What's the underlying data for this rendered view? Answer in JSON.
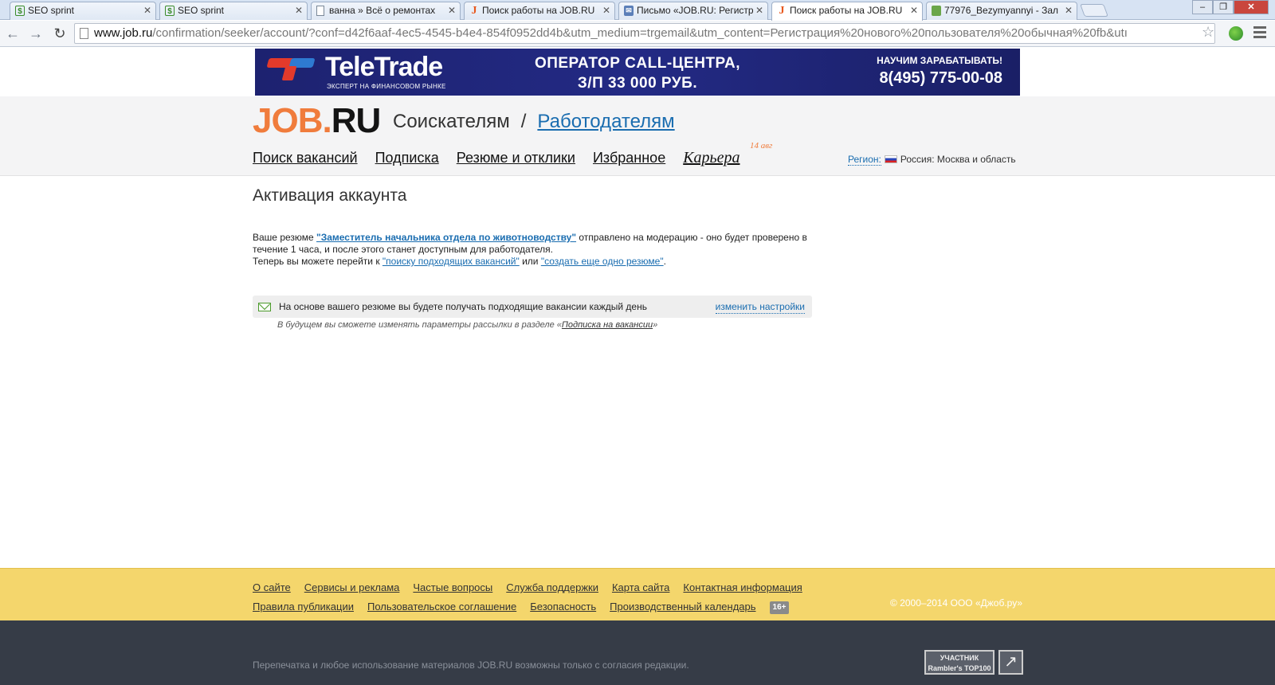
{
  "browser": {
    "tabs": [
      {
        "title": "SEO sprint",
        "icon": "seo-sprint-icon"
      },
      {
        "title": "SEO sprint",
        "icon": "seo-sprint-icon"
      },
      {
        "title": "ванна » Всё о ремонтах",
        "icon": "page-icon"
      },
      {
        "title": "Поиск работы на JOB.RU",
        "icon": "job-icon"
      },
      {
        "title": "Письмо «JOB.RU: Регистр",
        "icon": "mail-icon"
      },
      {
        "title": "Поиск работы на JOB.RU",
        "icon": "job-icon",
        "active": true
      },
      {
        "title": "77976_Bezymyannyi - Зал",
        "icon": "image-icon"
      }
    ],
    "url_host": "www.job.ru",
    "url_rest": "/confirmation/seeker/account/?conf=d42f6aaf-4ec5-4545-b4e4-854f0952dd4b&utm_medium=trgemail&utm_content=Регистрация%20нового%20пользователя%20обычная%20fb&utı"
  },
  "banner": {
    "brand": "TeleTrade",
    "tagline": "ЭКСПЕРТ НА ФИНАНСОВОМ РЫНКЕ",
    "offer_line1": "ОПЕРАТОР CALL-ЦЕНТРА,",
    "offer_line2": "З/П 33 000 РУБ.",
    "cta": "НАУЧИМ ЗАРАБАТЫВАТЬ!",
    "phone": "8(495) 775-00-08",
    "colors": {
      "bg": "#232a84",
      "red": "#e33a2b",
      "blue": "#2e7ad1"
    }
  },
  "header": {
    "logo_job": "JOB",
    "logo_dot": ".",
    "logo_ru": "RU",
    "seekers": "Соискателям",
    "separator": "/",
    "employers": "Работодателям",
    "nav": [
      "Поиск вакансий",
      "Подписка",
      "Резюме и отклики",
      "Избранное"
    ],
    "career": "Карьера",
    "career_date": "14 авг",
    "region_label": "Регион:",
    "region_value": "Россия: Москва и область",
    "accent": "#f07c3c"
  },
  "content": {
    "title": "Активация аккаунта",
    "msg_prefix": "Ваше резюме ",
    "resume_link": "\"Заместитель начальника отдела по животноводству\"",
    "msg_middle": " отправлено на модерацию - оно будет проверено в течение 1 часа, и после этого станет доступным для работодателя.",
    "msg_line2_prefix": "Теперь вы можете перейти к ",
    "search_link": "\"поиску подходящих вакансий\"",
    "or": " или ",
    "create_link": "\"создать еще одно резюме\"",
    "period": ".",
    "notice_text": "На основе вашего резюме вы будете получать подходящие вакансии каждый день",
    "notice_action": "изменить настройки",
    "note_prefix": "В будущем вы сможете изменять параметры рассылки в разделе «",
    "note_link": "Подписка на вакансии",
    "note_suffix": "»"
  },
  "footer": {
    "row1": [
      "О сайте",
      "Сервисы и реклама",
      "Частые вопросы",
      "Служба поддержки",
      "Карта сайта",
      "Контактная информация"
    ],
    "row2": [
      "Правила публикации",
      "Пользовательское соглашение",
      "Безопасность",
      "Производственный календарь"
    ],
    "age": "16+",
    "copyright": "© 2000–2014 ООО «Джоб.ру»",
    "reprint": "Перепечатка и любое использование материалов JOB.RU возможны только с согласия редакции.",
    "rambler_line1": "УЧАСТНИК",
    "rambler_line2": "Rambler's TOP100",
    "colors": {
      "top": "#f4d66c",
      "bottom": "#363c47"
    }
  }
}
